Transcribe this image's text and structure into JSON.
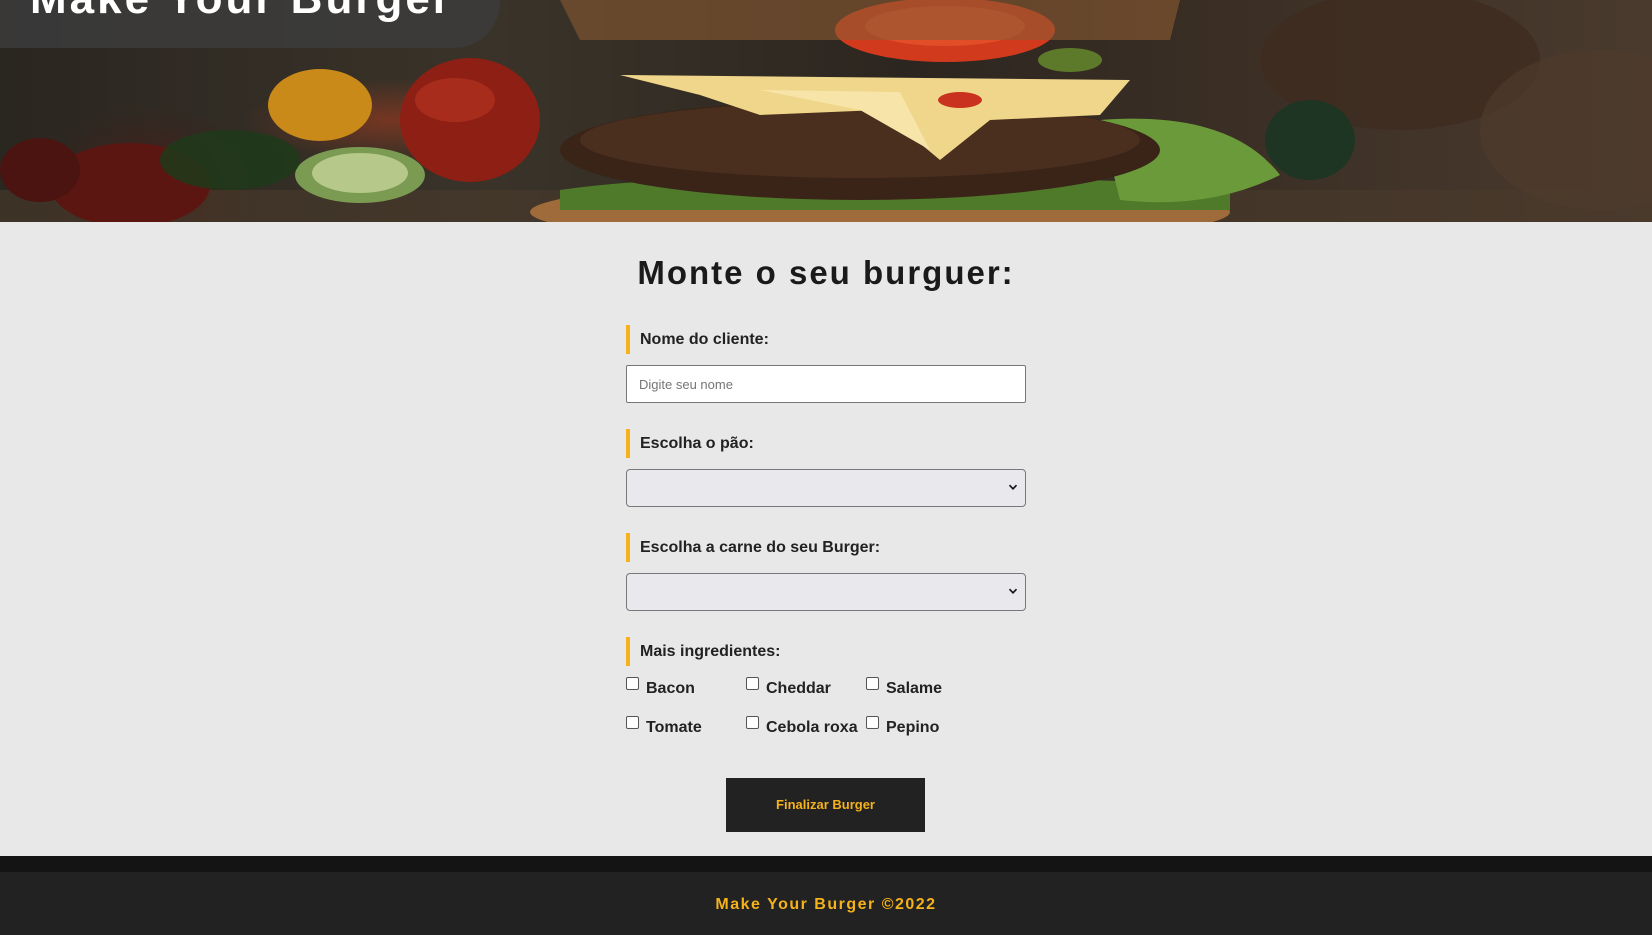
{
  "header": {
    "brand": "Make Your Burger"
  },
  "form": {
    "title": "Monte o seu burguer:",
    "name_label": "Nome do cliente:",
    "name_placeholder": "Digite seu nome",
    "name_value": "",
    "bread_label": "Escolha o pão:",
    "bread_selected": "",
    "meat_label": "Escolha a carne do seu Burger:",
    "meat_selected": "",
    "extras_label": "Mais ingredientes:",
    "extras": [
      {
        "label": "Bacon",
        "checked": false
      },
      {
        "label": "Cheddar",
        "checked": false
      },
      {
        "label": "Salame",
        "checked": false
      },
      {
        "label": "Tomate",
        "checked": false
      },
      {
        "label": "Cebola roxa",
        "checked": false
      },
      {
        "label": "Pepino",
        "checked": false
      }
    ],
    "submit_label": "Finalizar Burger"
  },
  "footer": {
    "text": "Make Your Burger ©2022"
  },
  "colors": {
    "accent": "#f5b21a",
    "dark": "#222222",
    "background": "#e8e8e8"
  }
}
